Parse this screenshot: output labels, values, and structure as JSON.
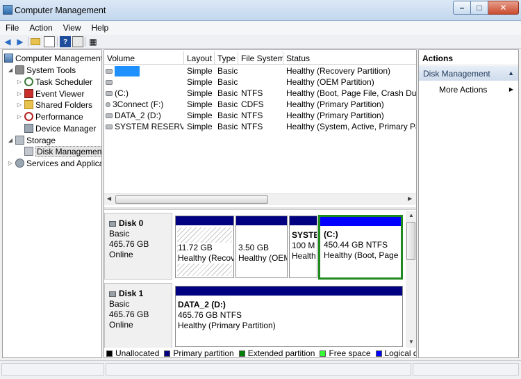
{
  "window": {
    "title": "Computer Management",
    "buttons": {
      "minimize": "–",
      "maximize": "□",
      "close": "✕"
    }
  },
  "menu": [
    "File",
    "Action",
    "View",
    "Help"
  ],
  "toolbar": {
    "icons": [
      "back-arrow-icon",
      "forward-arrow-icon",
      "up-folder-icon",
      "properties-icon",
      "help-icon",
      "show-hide-tree-icon",
      "export-icon"
    ]
  },
  "tree": [
    {
      "label": "Computer Management",
      "icon": "computer-icon",
      "level": 0,
      "expander": ""
    },
    {
      "label": "System Tools",
      "icon": "tools-icon",
      "level": 1,
      "expander": "◢"
    },
    {
      "label": "Task Scheduler",
      "icon": "clock-icon",
      "level": 2,
      "expander": "▷"
    },
    {
      "label": "Event Viewer",
      "icon": "event-viewer-icon",
      "level": 2,
      "expander": "▷"
    },
    {
      "label": "Shared Folders",
      "icon": "shared-folder-icon",
      "level": 2,
      "expander": "▷"
    },
    {
      "label": "Performance",
      "icon": "performance-icon",
      "level": 2,
      "expander": "▷"
    },
    {
      "label": "Device Manager",
      "icon": "device-manager-icon",
      "level": 2,
      "expander": ""
    },
    {
      "label": "Storage",
      "icon": "storage-icon",
      "level": 1,
      "expander": "◢"
    },
    {
      "label": "Disk Management",
      "icon": "disk-management-icon",
      "level": 2,
      "expander": "",
      "selected": true
    },
    {
      "label": "Services and Applicat",
      "icon": "services-icon",
      "level": 1,
      "expander": "▷"
    }
  ],
  "volumes": {
    "columns": [
      "Volume",
      "Layout",
      "Type",
      "File System",
      "Status"
    ],
    "rows": [
      {
        "volume": "",
        "redacted": true,
        "layout": "Simple",
        "type": "Basic",
        "fs": "",
        "status": "Healthy (Recovery Partition)"
      },
      {
        "volume": "",
        "redacted": false,
        "layout": "Simple",
        "type": "Basic",
        "fs": "",
        "status": "Healthy (OEM Partition)"
      },
      {
        "volume": "(C:)",
        "redacted": false,
        "layout": "Simple",
        "type": "Basic",
        "fs": "NTFS",
        "status": "Healthy (Boot, Page File, Crash Dump"
      },
      {
        "volume": "3Connect (F:)",
        "redacted": false,
        "layout": "Simple",
        "type": "Basic",
        "fs": "CDFS",
        "status": "Healthy (Primary Partition)"
      },
      {
        "volume": "DATA_2 (D:)",
        "redacted": false,
        "layout": "Simple",
        "type": "Basic",
        "fs": "NTFS",
        "status": "Healthy (Primary Partition)"
      },
      {
        "volume": "SYSTEM RESERVED",
        "redacted": false,
        "layout": "Simple",
        "type": "Basic",
        "fs": "NTFS",
        "status": "Healthy (System, Active, Primary Parti"
      }
    ]
  },
  "disks": [
    {
      "name": "Disk 0",
      "type": "Basic",
      "size": "465.76 GB",
      "state": "Online",
      "partitions": [
        {
          "title": "",
          "size": "11.72 GB",
          "status": "Healthy (Recov",
          "style": "hatched"
        },
        {
          "title": "",
          "size": "3.50 GB",
          "status": "Healthy (OEM",
          "style": "normal"
        },
        {
          "title": "SYSTE",
          "size": "100 M",
          "status": "Health",
          "style": "normal"
        },
        {
          "title": "(C:)",
          "size": "450.44 GB NTFS",
          "status": "Healthy (Boot, Page I",
          "style": "selected"
        }
      ]
    },
    {
      "name": "Disk 1",
      "type": "Basic",
      "size": "465.76 GB",
      "state": "Online",
      "partitions": [
        {
          "title": "DATA_2  (D:)",
          "size": "465.76 GB NTFS",
          "status": "Healthy (Primary Partition)",
          "style": "normal"
        }
      ]
    }
  ],
  "legend": [
    {
      "label": "Unallocated",
      "color": "#000000"
    },
    {
      "label": "Primary partition",
      "color": "#000080"
    },
    {
      "label": "Extended partition",
      "color": "#008000"
    },
    {
      "label": "Free space",
      "color": "#33ff33"
    },
    {
      "label": "Logical drive",
      "color": "#0000ff"
    }
  ],
  "actions": {
    "title": "Actions",
    "section": "Disk Management",
    "items": [
      "More Actions"
    ]
  }
}
